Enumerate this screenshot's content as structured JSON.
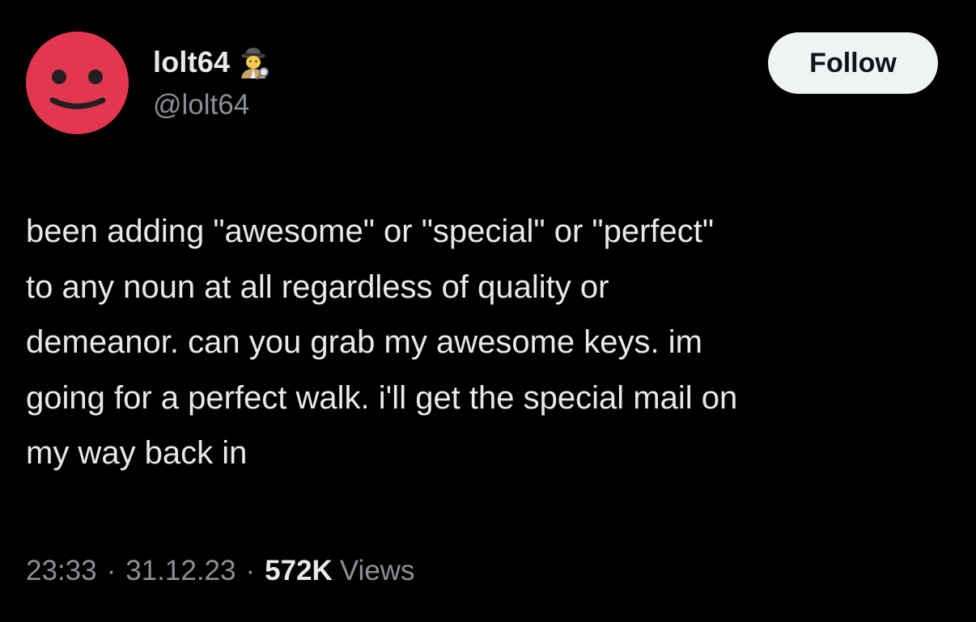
{
  "colors": {
    "background": "#000000",
    "text_primary": "#e7e9ea",
    "text_secondary": "#8b9096",
    "avatar_bg": "#e2374f",
    "follow_button_bg": "#eff3f4",
    "follow_button_text": "#0f1419"
  },
  "author": {
    "display_name": "lolt64",
    "badge_icon": "detective-emoji-icon",
    "handle": "@lolt64",
    "avatar_icon": "smiley-face-icon"
  },
  "follow_button": {
    "label": "Follow"
  },
  "tweet": {
    "lines": [
      "been adding \"awesome\" or \"special\" or \"perfect\"",
      "to any noun at all regardless of quality or",
      "demeanor. can you grab my awesome keys. im",
      "going for a perfect walk. i'll get the special mail on",
      "my way back in"
    ]
  },
  "meta": {
    "time": "23:33",
    "separator": "·",
    "date": "31.12.23",
    "views_count": "572K",
    "views_label": "Views"
  }
}
